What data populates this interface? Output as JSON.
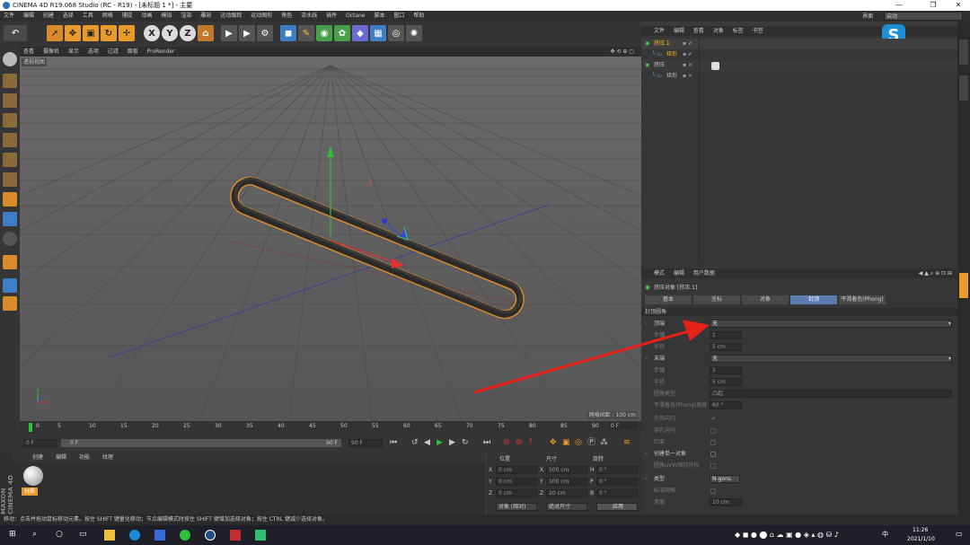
{
  "window": {
    "title": "CINEMA 4D R19.068 Studio (RC - R19) - [未标题 1 *] - 主要",
    "controls": [
      "minimize",
      "maximize",
      "close"
    ]
  },
  "menubar": {
    "items": [
      "文件",
      "编辑",
      "创建",
      "选择",
      "工具",
      "网格",
      "捕捉",
      "动画",
      "模拟",
      "渲染",
      "雕刻",
      "运动跟踪",
      "运动图形",
      "角色",
      "流水线",
      "插件",
      "Octane",
      "脚本",
      "窗口",
      "帮助"
    ],
    "layout_label": "界面",
    "layout_value": "启动"
  },
  "viewport": {
    "menu": [
      "查看",
      "摄像机",
      "显示",
      "选项",
      "过滤",
      "面板",
      "ProRender"
    ],
    "camera_label": "透视视图",
    "grid_label": "网格间距 : 100 cm"
  },
  "timeline": {
    "ticks": [
      "0",
      "5",
      "10",
      "15",
      "20",
      "25",
      "30",
      "35",
      "40",
      "45",
      "50",
      "55",
      "60",
      "65",
      "70",
      "75",
      "80",
      "85",
      "90"
    ],
    "end_frame": "0 F"
  },
  "timectrl": {
    "start": "0 F",
    "current": "0 F",
    "range_end": "90 F",
    "end": "90 F"
  },
  "materials": {
    "menu": [
      "创建",
      "编辑",
      "功能",
      "纹理"
    ],
    "material_name": "材质",
    "brand": "MAXON CINEMA 4D"
  },
  "coords": {
    "headers": [
      "位置",
      "尺寸",
      "旋转"
    ],
    "rows": [
      {
        "axis": "X",
        "pos": "0 cm",
        "size_axis": "X",
        "size": "500 cm",
        "rot_axis": "H",
        "rot": "0 °"
      },
      {
        "axis": "Y",
        "pos": "0 cm",
        "size_axis": "Y",
        "size": "100 cm",
        "rot_axis": "P",
        "rot": "0 °"
      },
      {
        "axis": "Z",
        "pos": "0 cm",
        "size_axis": "Z",
        "size": "20 cm",
        "rot_axis": "B",
        "rot": "0 °"
      }
    ],
    "mode": "对象 (相对)",
    "size_mode": "绝对尺寸",
    "apply": "应用"
  },
  "objects": {
    "menu": [
      "文件",
      "编辑",
      "查看",
      "对象",
      "标签",
      "书签"
    ],
    "tree": [
      {
        "name": "挤压.1",
        "indent": 0,
        "color": "#f0c020"
      },
      {
        "name": "矩形",
        "indent": 1,
        "color": "#f0c020"
      },
      {
        "name": "挤压",
        "indent": 0,
        "color": "#cfcfcf"
      },
      {
        "name": "矩形",
        "indent": 1,
        "color": "#cfcfcf"
      }
    ]
  },
  "attributes": {
    "menu": [
      "模式",
      "编辑",
      "用户数据"
    ],
    "object_title": "挤压对象 [挤压.1]",
    "tabs": [
      "基本",
      "坐标",
      "对象",
      "封顶",
      "平滑着色(Phong)"
    ],
    "active_tab": "封顶",
    "section": "封顶圆角",
    "rows": [
      {
        "label": "顶端",
        "value": "无",
        "type": "select",
        "enabled": true
      },
      {
        "label": "步幅",
        "value": "1",
        "type": "num",
        "enabled": false
      },
      {
        "label": "半径",
        "value": "5 cm",
        "type": "num",
        "enabled": false
      },
      {
        "label": "末端",
        "value": "无",
        "type": "select",
        "enabled": true
      },
      {
        "label": "步幅",
        "value": "1",
        "type": "num",
        "enabled": false
      },
      {
        "label": "半径",
        "value": "5 cm",
        "type": "num",
        "enabled": false
      },
      {
        "label": "圆角类型",
        "value": "凸起",
        "type": "select",
        "enabled": false
      },
      {
        "label": "平滑着色(Phong)角度",
        "value": "60 °",
        "type": "num",
        "enabled": false
      },
      {
        "label": "外壳向内",
        "value": "✔",
        "type": "check",
        "enabled": false
      },
      {
        "label": "穿孔向内",
        "value": "",
        "type": "check",
        "enabled": false
      },
      {
        "label": "约束",
        "value": "",
        "type": "check",
        "enabled": false
      },
      {
        "label": "创建单一对象",
        "value": "",
        "type": "check",
        "enabled": true
      },
      {
        "label": "圆角UVW保持外形",
        "value": "",
        "type": "check",
        "enabled": false
      },
      {
        "label": "类型",
        "value": "N-gons",
        "type": "button",
        "enabled": true
      },
      {
        "label": "标准网格",
        "value": "",
        "type": "check",
        "enabled": false
      },
      {
        "label": "宽度",
        "value": "10 cm",
        "type": "num",
        "enabled": false
      }
    ]
  },
  "status": {
    "text": "移动：点击并拖动鼠标移动元素。按住 SHIFT 键量化移动；节点编辑模式时按住 SHIFT 键增加选择对象；按住 CTRL 键减少选择对象。"
  },
  "taskbar": {
    "time": "11:26",
    "date": "2021/1/10",
    "ime": "中"
  },
  "colors": {
    "accent": "#f5a623",
    "selection": "#f0c020",
    "arrow": "#e8201a",
    "active_tab": "#5a7ab0"
  }
}
